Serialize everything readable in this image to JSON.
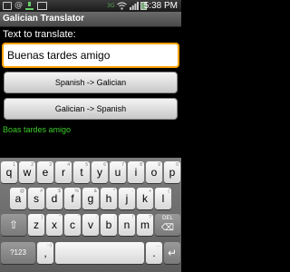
{
  "status_bar": {
    "time": "5:38 PM",
    "network": "3G",
    "icons": [
      "usb-icon",
      "at-icon",
      "download-icon",
      "mail-icon",
      "3g-icon",
      "wifi-icon",
      "signal-icon",
      "battery-icon"
    ]
  },
  "app": {
    "title": "Galician Translator"
  },
  "main": {
    "prompt": "Text to translate:",
    "input_value": "Buenas tardes amigo",
    "button_es_gl": "Spanish -> Galician",
    "button_gl_es": "Galician -> Spanish",
    "result": "Boas tardes amigo"
  },
  "keyboard": {
    "row1": [
      {
        "label": "q",
        "alt": "1"
      },
      {
        "label": "w",
        "alt": "2"
      },
      {
        "label": "e",
        "alt": "3"
      },
      {
        "label": "r",
        "alt": "4"
      },
      {
        "label": "t",
        "alt": "5"
      },
      {
        "label": "y",
        "alt": "6"
      },
      {
        "label": "u",
        "alt": "7"
      },
      {
        "label": "i",
        "alt": "8"
      },
      {
        "label": "o",
        "alt": "9"
      },
      {
        "label": "p",
        "alt": "0"
      }
    ],
    "row2": [
      {
        "label": "a",
        "alt": "@"
      },
      {
        "label": "s",
        "alt": "#"
      },
      {
        "label": "d",
        "alt": "$"
      },
      {
        "label": "f",
        "alt": "%"
      },
      {
        "label": "g",
        "alt": "&"
      },
      {
        "label": "h",
        "alt": "*"
      },
      {
        "label": "j",
        "alt": "-"
      },
      {
        "label": "k",
        "alt": "+"
      },
      {
        "label": "l",
        "alt": "("
      }
    ],
    "row3": [
      {
        "label": "z",
        "alt": ")"
      },
      {
        "label": "x",
        "alt": "\""
      },
      {
        "label": "c",
        "alt": "'"
      },
      {
        "label": "v",
        "alt": ":"
      },
      {
        "label": "b",
        "alt": ";"
      },
      {
        "label": "n",
        "alt": "!"
      },
      {
        "label": "m",
        "alt": "?"
      }
    ],
    "shift": "⇧",
    "del_label": "DEL",
    "del_glyph": "⌫",
    "sym_label": "?123",
    "comma": ",",
    "comma_alt": ":-)",
    "period": ".",
    "period_alt": "…",
    "space": "",
    "enter": "↵"
  },
  "colors": {
    "accent_focus": "#f9a000",
    "result_text": "#3ccd2a",
    "title_bar": "#5a5a5a",
    "background": "#000000"
  }
}
